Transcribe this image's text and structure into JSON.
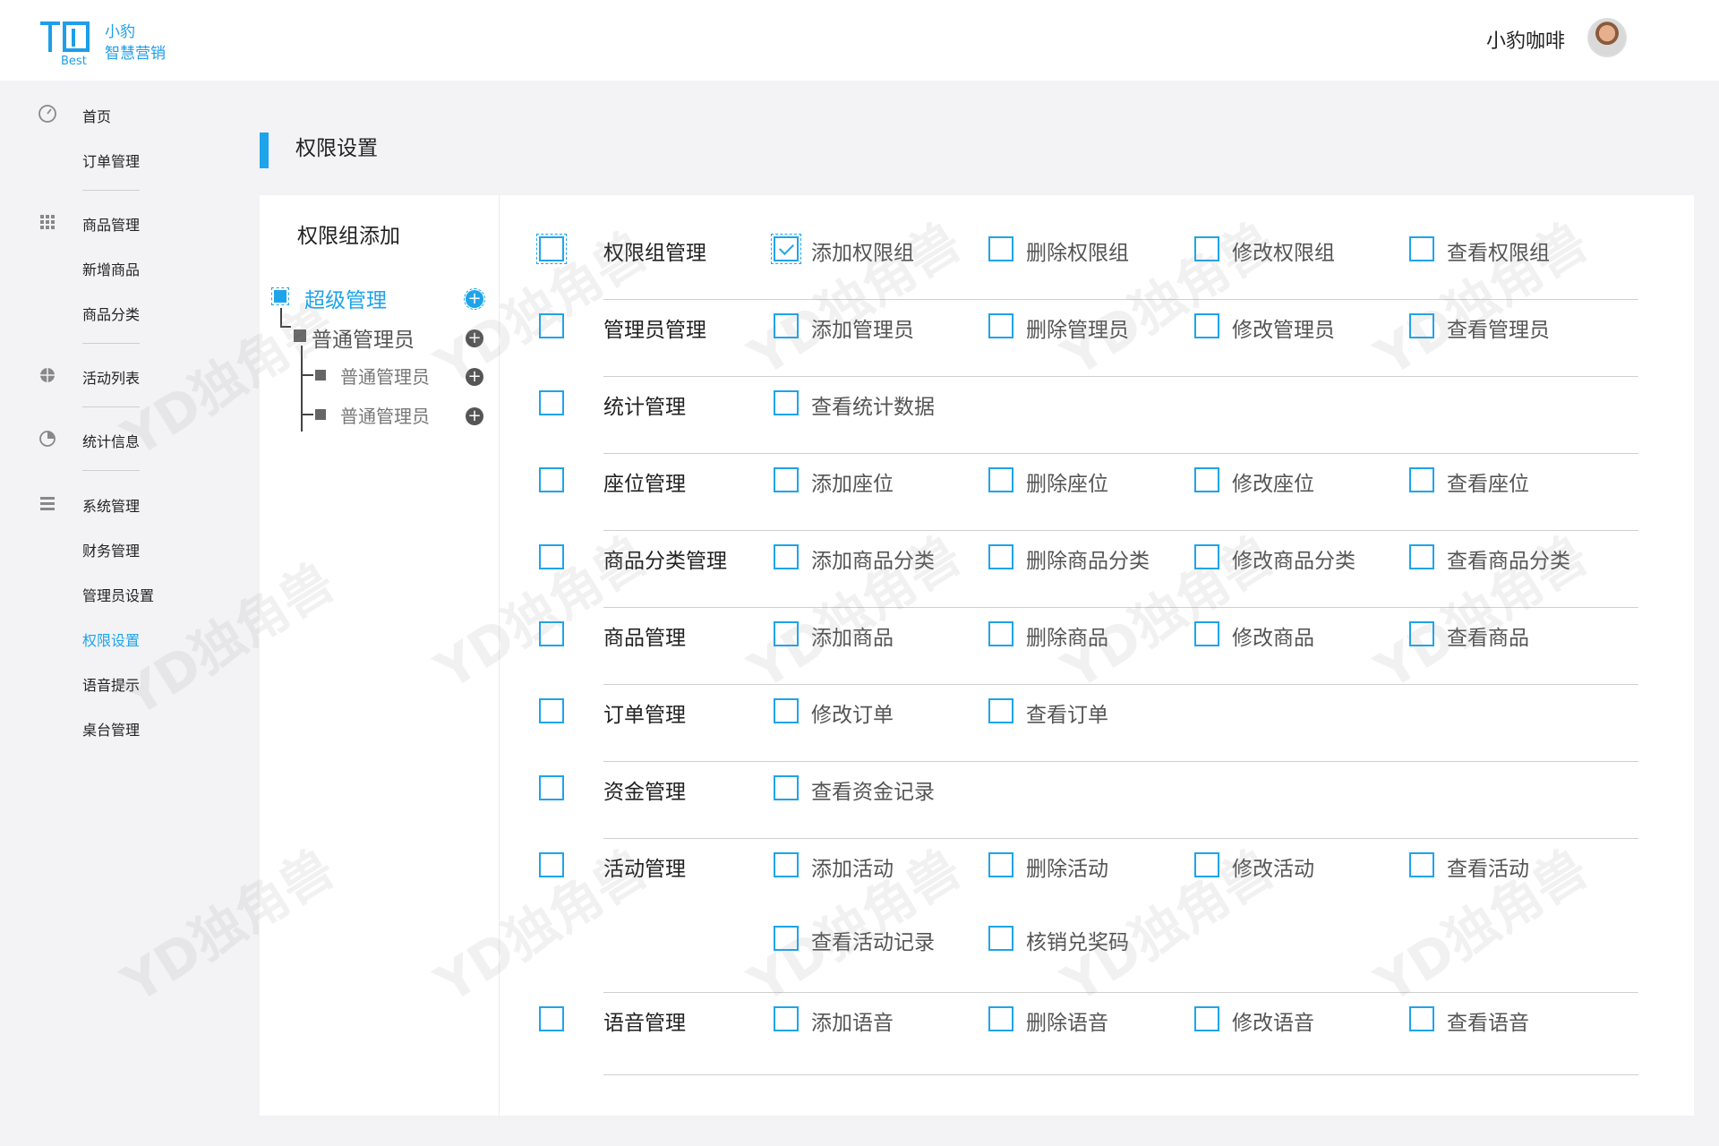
{
  "brand": {
    "line1": "小豹",
    "line2": "智慧营销",
    "mark_text": "Best"
  },
  "user": {
    "name": "小豹咖啡"
  },
  "sidebar": {
    "items": [
      {
        "label": "首页",
        "icon": "dashboard-icon"
      },
      {
        "label": "订单管理"
      },
      {
        "label": "商品管理",
        "icon": "grid-icon"
      },
      {
        "label": "新增商品"
      },
      {
        "label": "商品分类"
      },
      {
        "label": "活动列表",
        "icon": "globe-icon"
      },
      {
        "label": "统计信息",
        "icon": "pie-chart-icon"
      },
      {
        "label": "系统管理",
        "icon": "list-icon"
      },
      {
        "label": "财务管理"
      },
      {
        "label": "管理员设置"
      },
      {
        "label": "权限设置",
        "active": true
      },
      {
        "label": "语音提示"
      },
      {
        "label": "桌台管理"
      }
    ]
  },
  "page": {
    "title": "权限设置"
  },
  "tree": {
    "title": "权限组添加",
    "root": "超级管理",
    "child": "普通管理员",
    "grandchildren": [
      "普通管理员",
      "普通管理员"
    ]
  },
  "permissions": [
    {
      "group": "权限组管理",
      "items": [
        "添加权限组",
        "删除权限组",
        "修改权限组",
        "查看权限组"
      ],
      "checked": [
        0
      ]
    },
    {
      "group": "管理员管理",
      "items": [
        "添加管理员",
        "删除管理员",
        "修改管理员",
        "查看管理员"
      ]
    },
    {
      "group": "统计管理",
      "items": [
        "查看统计数据"
      ]
    },
    {
      "group": "座位管理",
      "items": [
        "添加座位",
        "删除座位",
        "修改座位",
        "查看座位"
      ]
    },
    {
      "group": "商品分类管理",
      "items": [
        "添加商品分类",
        "删除商品分类",
        "修改商品分类",
        "查看商品分类"
      ]
    },
    {
      "group": "商品管理",
      "items": [
        "添加商品",
        "删除商品",
        "修改商品",
        "查看商品"
      ]
    },
    {
      "group": "订单管理",
      "items": [
        "修改订单",
        "查看订单"
      ]
    },
    {
      "group": "资金管理",
      "items": [
        "查看资金记录"
      ]
    },
    {
      "group": "活动管理",
      "items": [
        "添加活动",
        "删除活动",
        "修改活动",
        "查看活动",
        "查看活动记录",
        "核销兑奖码"
      ]
    },
    {
      "group": "语音管理",
      "items": [
        "添加语音",
        "删除语音",
        "修改语音",
        "查看语音"
      ]
    }
  ],
  "watermark": "YD独角兽",
  "colors": {
    "accent": "#1ea4ea",
    "background": "#f3f3f5"
  }
}
